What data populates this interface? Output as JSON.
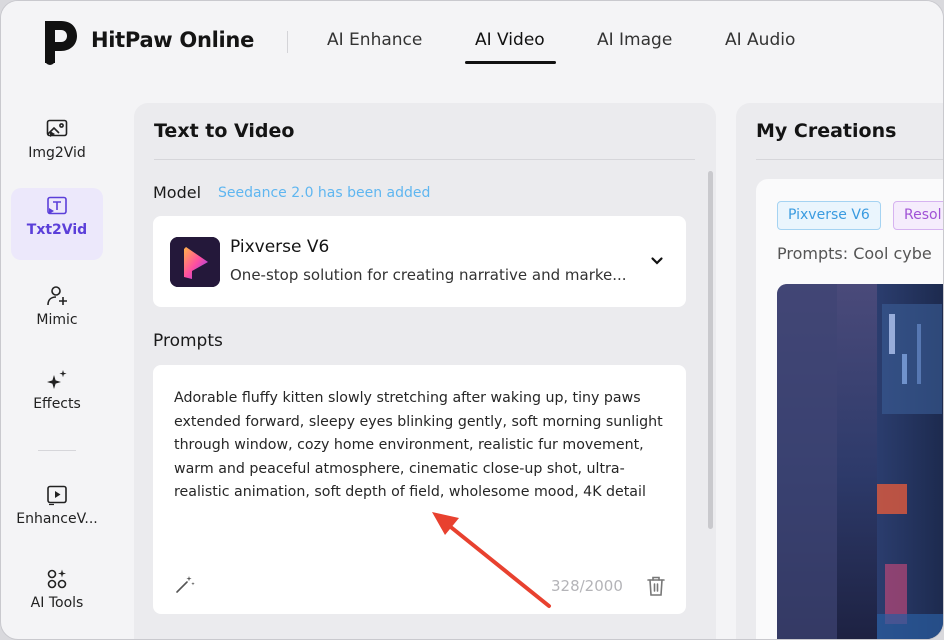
{
  "header": {
    "brand": "HitPaw Online",
    "nav": [
      "AI Enhance",
      "AI Video",
      "AI Image",
      "AI Audio"
    ],
    "active_nav": "AI Video"
  },
  "sidebar": {
    "items": [
      {
        "label": "Img2Vid",
        "icon": "image-to-video-icon"
      },
      {
        "label": "Txt2Vid",
        "icon": "text-to-video-icon",
        "active": true
      },
      {
        "label": "Mimic",
        "icon": "person-sparkle-icon"
      },
      {
        "label": "Effects",
        "icon": "sparkles-icon"
      },
      {
        "label": "EnhanceV...",
        "icon": "hd-video-icon"
      },
      {
        "label": "AI Tools",
        "icon": "tools-grid-icon"
      }
    ]
  },
  "main": {
    "title": "Text to Video",
    "model_label": "Model",
    "model_note": "Seedance 2.0 has been added",
    "model": {
      "name": "Pixverse V6",
      "description": "One-stop solution for creating narrative and marke..."
    },
    "prompts_label": "Prompts",
    "prompt_text": "Adorable fluffy kitten slowly stretching after waking up, tiny paws extended forward, sleepy eyes blinking gently, soft morning sunlight through window, cozy home environment, realistic fur movement, warm and peaceful atmosphere, cinematic close-up shot, ultra-realistic animation, soft depth of field, wholesome mood, 4K detail",
    "counter": "328/2000"
  },
  "creations": {
    "title": "My Creations",
    "tags": [
      "Pixverse V6",
      "Resol"
    ],
    "prompt_preview": "Prompts: Cool cybe"
  },
  "colors": {
    "accent": "#5b3fd9",
    "note": "#5fb6f0",
    "annotation_arrow": "#e8412f"
  }
}
